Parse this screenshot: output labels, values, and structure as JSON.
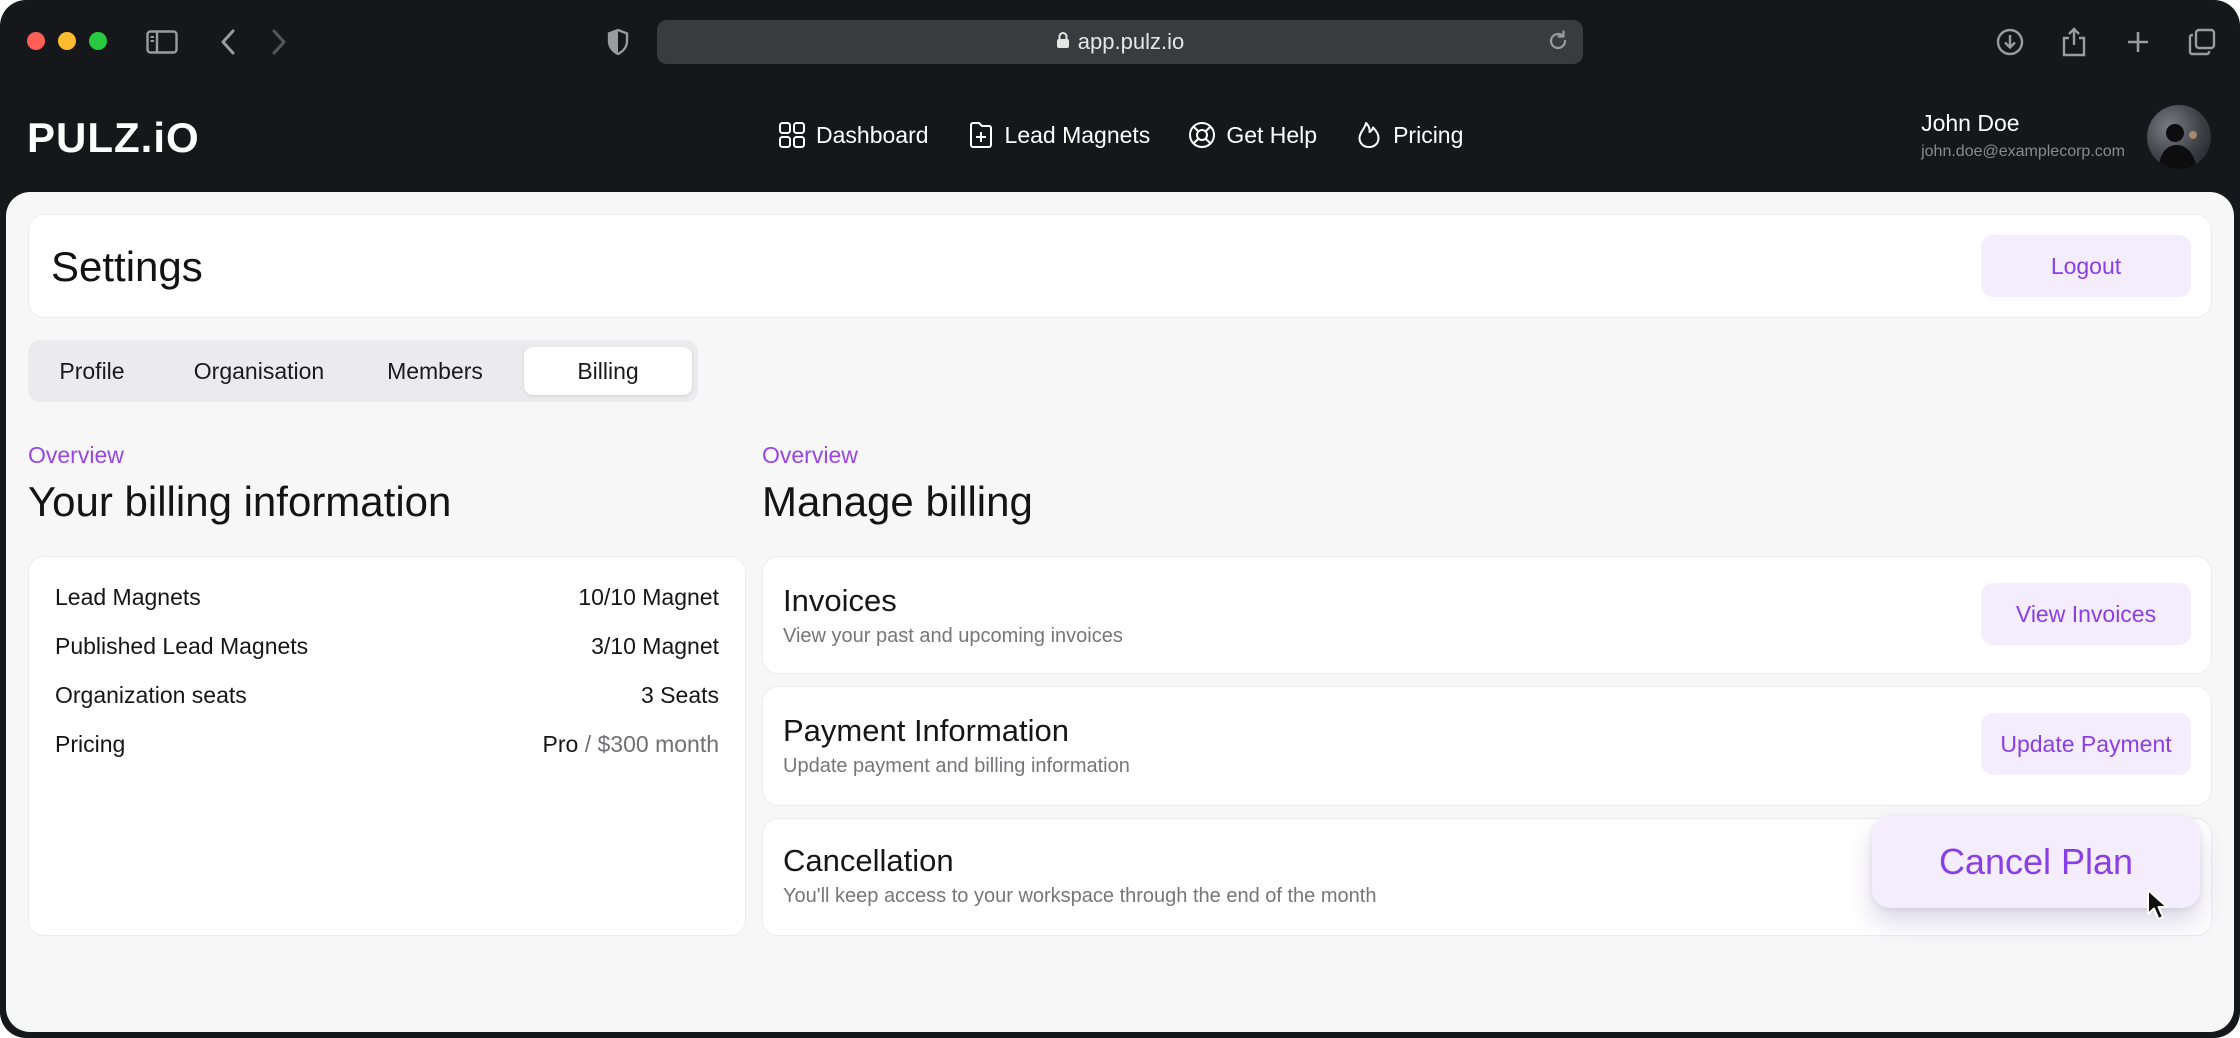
{
  "browser": {
    "url": "app.pulz.io",
    "icons": [
      "sidebar-icon",
      "back-icon",
      "forward-icon",
      "shield-icon",
      "lock-icon",
      "reload-icon",
      "download-icon",
      "share-icon",
      "new-tab-icon",
      "tabs-overview-icon"
    ]
  },
  "header": {
    "logo": "PULZ.iO",
    "nav": [
      {
        "label": "Dashboard",
        "icon": "grid-icon"
      },
      {
        "label": "Lead Magnets",
        "icon": "file-plus-icon"
      },
      {
        "label": "Get Help",
        "icon": "lifebuoy-icon"
      },
      {
        "label": "Pricing",
        "icon": "flame-icon"
      }
    ],
    "user": {
      "name": "John Doe",
      "email": "john.doe@examplecorp.com"
    }
  },
  "settings": {
    "title": "Settings",
    "logout_label": "Logout"
  },
  "tabs": [
    {
      "label": "Profile",
      "active": false
    },
    {
      "label": "Organisation",
      "active": false
    },
    {
      "label": "Members",
      "active": false
    },
    {
      "label": "Billing",
      "active": true
    }
  ],
  "billing_info": {
    "eyebrow": "Overview",
    "title": "Your billing information",
    "rows": [
      {
        "label": "Lead Magnets",
        "value": "10/10 Magnet"
      },
      {
        "label": "Published Lead Magnets",
        "value": "3/10 Magnet"
      },
      {
        "label": "Organization seats",
        "value": "3 Seats"
      },
      {
        "label": "Pricing",
        "value_plan": "Pro",
        "value_price": " / $300 month"
      }
    ]
  },
  "manage_billing": {
    "eyebrow": "Overview",
    "title": "Manage billing",
    "items": [
      {
        "title": "Invoices",
        "description": "View your past and upcoming invoices",
        "button": "View Invoices"
      },
      {
        "title": "Payment Information",
        "description": "Update payment and billing information",
        "button": "Update Payment"
      },
      {
        "title": "Cancellation",
        "description": "You'll keep access to your workspace through the end of the month",
        "button": "Cancel Plan"
      }
    ]
  },
  "colors": {
    "accent": "#8a3ee8",
    "accent_soft": "#f3edfd",
    "chrome_bg": "#16171a",
    "content_bg": "#f7f7f8"
  }
}
